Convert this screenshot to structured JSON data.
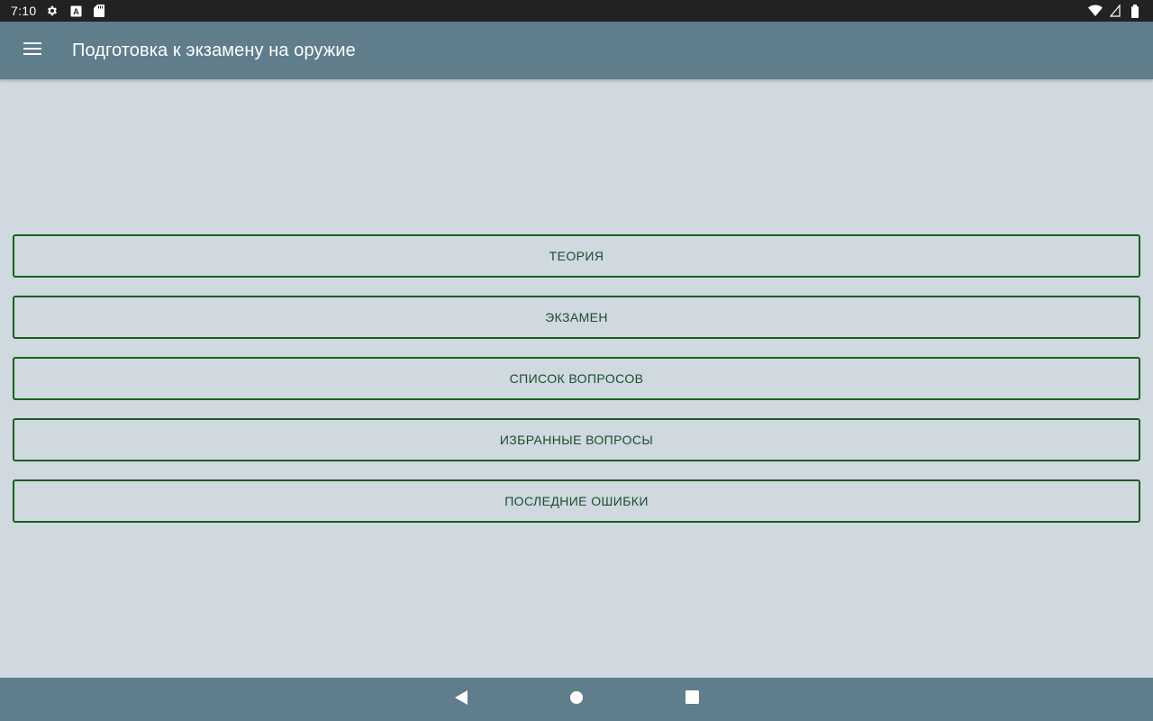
{
  "status_bar": {
    "time": "7:10",
    "left_icons": [
      "gear-icon",
      "a-letter-icon",
      "sd-card-icon"
    ],
    "right_icons": [
      "wifi-icon",
      "signal-icon",
      "battery-icon"
    ]
  },
  "app_bar": {
    "menu_icon": "hamburger-menu-icon",
    "title": "Подготовка к экзамену на оружие",
    "background_color": "#607d8b"
  },
  "menu": {
    "items": [
      {
        "label": "ТЕОРИЯ"
      },
      {
        "label": "ЭКЗАМЕН"
      },
      {
        "label": "СПИСОК ВОПРОСОВ"
      },
      {
        "label": "ИЗБРАННЫЕ ВОПРОСЫ"
      },
      {
        "label": "ПОСЛЕДНИЕ ОШИБКИ"
      }
    ],
    "border_color": "#1b5e20"
  },
  "nav_bar": {
    "icons": [
      "back-icon",
      "home-icon",
      "recents-icon"
    ],
    "background_color": "#607d8b"
  },
  "colors": {
    "content_background": "#d0d8e0",
    "status_bar": "#222222"
  }
}
